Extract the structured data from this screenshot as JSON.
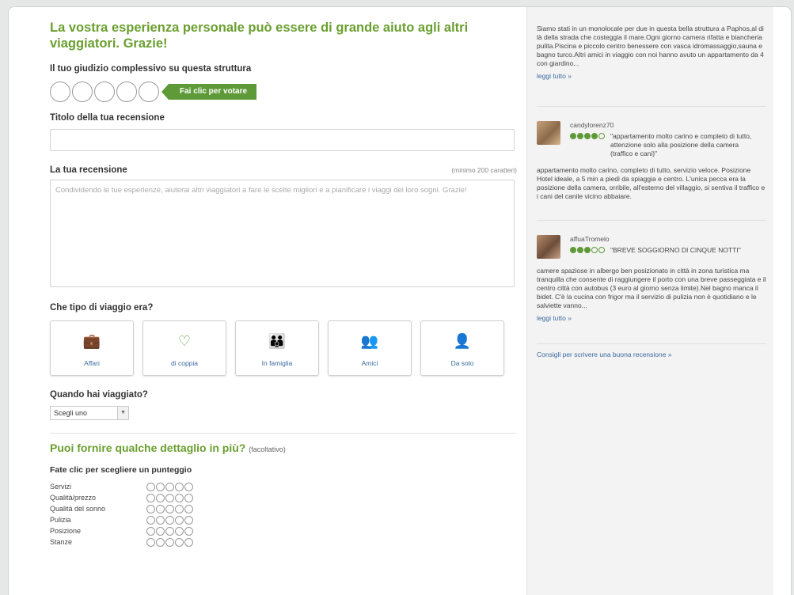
{
  "form": {
    "headline": "La vostra esperienza personale può essere di grande aiuto agli altri viaggiatori. Grazie!",
    "overall_label": "Il tuo giudizio complessivo su questa struttura",
    "vote_hint": "Fai clic per votare",
    "title_label": "Titolo della tua recensione",
    "title_value": "",
    "review_label": "La tua recensione",
    "review_min": "(minimo 200 caratteri)",
    "review_placeholder": "Condividendo le tue esperienze, aiuterai altri viaggiatori a fare le scelte migliori e a pianificare i viaggi dei loro sogni. Grazie!",
    "trip_type_label": "Che tipo di viaggio era?",
    "trip_types": [
      {
        "label": "Affari",
        "icon": "briefcase-icon"
      },
      {
        "label": "di coppia",
        "icon": "couple-heart-icon"
      },
      {
        "label": "In famiglia",
        "icon": "family-icon"
      },
      {
        "label": "Amici",
        "icon": "friends-icon"
      },
      {
        "label": "Da solo",
        "icon": "solo-icon"
      }
    ],
    "when_label": "Quando hai viaggiato?",
    "when_select": "Scegli uno",
    "details_heading": "Puoi fornire qualche dettaglio in più?",
    "details_optional": "(facoltativo)",
    "score_label": "Fate clic per scegliere un punteggio",
    "ratings": [
      "Servizi",
      "Qualità/prezzo",
      "Qualità del sonno",
      "Pulizia",
      "Posizione",
      "Stanze"
    ]
  },
  "sidebar": {
    "intro_text": "Siamo stati in un monolocale per due in questa bella struttura a Paphos,al di là della strada che costeggia il mare.Ogni giorno camera rifatta e biancheria pulita.Piscina e piccolo centro benessere con vasca idromassaggio,sauna e bagno turco.Altri amici in viaggio con noi hanno avuto un appartamento da 4 con giardino...",
    "read_more": "leggi tutto »",
    "reviews": [
      {
        "user": "candylorenz70",
        "rating": 4,
        "title": "\"appartamento molto carino e completo di tutto, attenzione solo alla posizione della camera (traffico e cani)\"",
        "body": "appartamento molto carino, completo di tutto, servizio veloce. Posizione Hotel ideale, a 5 min a piedi da spiaggia e centro. L'unica pecca era la posizione della camera, orribile, all'esterno del villaggio, si sentiva il traffico e i cani del canile vicino abbaiare."
      },
      {
        "user": "affuaTromelo",
        "rating": 3,
        "title": "\"BREVE SOGGIORNO DI CINQUE NOTTI\"",
        "body": "camere spaziose in albergo ben posizionato in città in zona turistica ma tranquilla che consente di raggiungere il porto con una breve passeggiata e il centro città con autobus (3 euro al giorno senza limite).Nel bagno manca il bidet. C'è la cucina con frigor ma il servizio di pulizia non è quotidiano e le salviette vanno...",
        "read_more": "leggi tutto »"
      }
    ],
    "tips_link": "Consigli per scrivere una buona recensione »"
  },
  "colors": {
    "accent_green": "#6a9f2f",
    "button_green": "#5e9a38",
    "link_blue": "#3b6aa0"
  }
}
